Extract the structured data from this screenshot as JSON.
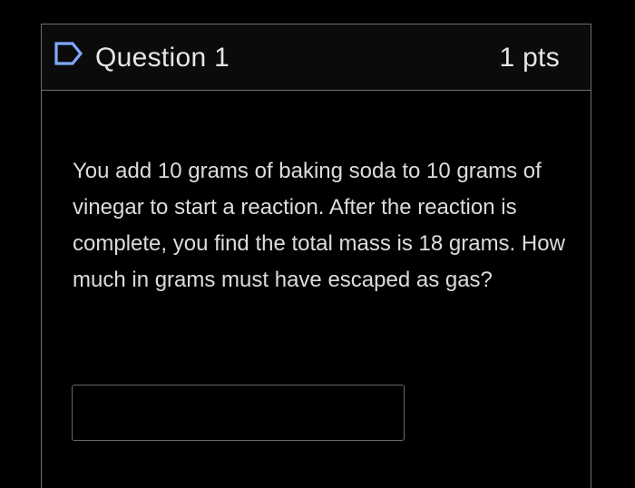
{
  "question": {
    "title": "Question 1",
    "points": "1 pts",
    "flag_icon": "flag-outline-icon",
    "text": "You add 10 grams of baking soda to 10 grams of vinegar to start a reaction. After the reaction is complete, you find the total mass is 18 grams. How much in grams must have escaped as gas?",
    "answer_value": ""
  },
  "colors": {
    "background": "#000000",
    "header_background": "#0b0b0b",
    "border": "#6e6e6e",
    "text": "#dcdcdc",
    "flag_accent": "#7fa8ff"
  }
}
